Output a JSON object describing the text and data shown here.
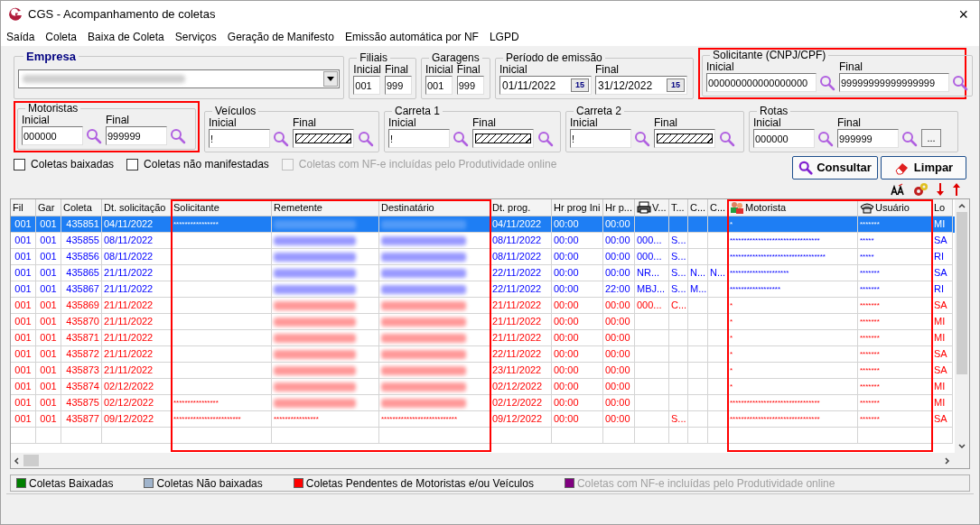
{
  "window": {
    "title": "CGS - Acompanhamento de coletas",
    "close": "×"
  },
  "menu": [
    "Saída",
    "Coleta",
    "Baixa de Coleta",
    "Serviços",
    "Geração de Manifesto",
    "Emissão automática por NF",
    "LGPD"
  ],
  "empresa": {
    "label": "Empresa"
  },
  "filters_row_1": [
    {
      "label": "Filiais",
      "highlighted": false,
      "fields": [
        {
          "label": "Inicial",
          "value": "001",
          "kind": "short"
        },
        {
          "label": "Final",
          "value": "999",
          "kind": "short"
        }
      ]
    },
    {
      "label": "Garagens",
      "highlighted": false,
      "fields": [
        {
          "label": "Inicial",
          "value": "001",
          "kind": "short"
        },
        {
          "label": "Final",
          "value": "999",
          "kind": "short"
        }
      ]
    },
    {
      "label": "Período de emissão",
      "highlighted": false,
      "fields": [
        {
          "label": "Inicial",
          "value": "01/11/2022",
          "kind": "date",
          "button": "15"
        },
        {
          "label": "Final",
          "value": "31/12/2022",
          "kind": "date",
          "button": "15"
        }
      ]
    },
    {
      "label": "Solicitante (CNPJ/CPF)",
      "highlighted": true,
      "fields": [
        {
          "label": "Inicial",
          "value": "000000000000000000",
          "kind": "lookup"
        },
        {
          "label": "Final",
          "value": "99999999999999999",
          "kind": "lookup"
        }
      ]
    }
  ],
  "filters_row_2": [
    {
      "label": "Motoristas",
      "highlighted": true,
      "fields": [
        {
          "label": "Inicial",
          "value": "000000",
          "kind": "lookup"
        },
        {
          "label": "Final",
          "value": "999999",
          "kind": "lookup"
        }
      ]
    },
    {
      "label": "Veículos",
      "highlighted": false,
      "fields": [
        {
          "label": "Inicial",
          "value": "!",
          "kind": "lookup"
        },
        {
          "label": "Final",
          "kind": "hatched"
        }
      ]
    },
    {
      "label": "Carreta 1",
      "highlighted": false,
      "fields": [
        {
          "label": "Inicial",
          "value": "!",
          "kind": "lookup"
        },
        {
          "label": "Final",
          "kind": "hatched"
        }
      ]
    },
    {
      "label": "Carreta 2",
      "highlighted": false,
      "fields": [
        {
          "label": "Inicial",
          "value": "!",
          "kind": "lookup"
        },
        {
          "label": "Final",
          "kind": "hatched"
        }
      ]
    },
    {
      "label": "Rotas",
      "highlighted": false,
      "more": "...",
      "fields": [
        {
          "label": "Inicial",
          "value": "000000",
          "kind": "lookup"
        },
        {
          "label": "Final",
          "value": "999999",
          "kind": "lookup"
        }
      ]
    }
  ],
  "checkboxes": [
    {
      "label": "Coletas baixadas",
      "checked": false,
      "disabled": false
    },
    {
      "label": "Coletas não manifestadas",
      "checked": false,
      "disabled": false
    },
    {
      "label": "Coletas com NF-e incluídas pelo Produtividade online",
      "checked": false,
      "disabled": true
    }
  ],
  "buttons": [
    "Consultar",
    "Limpar"
  ],
  "table": {
    "columns": [
      {
        "label": "Fil",
        "highlighted": false
      },
      {
        "label": "Gar",
        "highlighted": false
      },
      {
        "label": "Coleta",
        "highlighted": false
      },
      {
        "label": "Dt. solicitação",
        "highlighted": false
      },
      {
        "label": "Solicitante",
        "highlighted": true
      },
      {
        "label": "Remetente",
        "highlighted": true
      },
      {
        "label": "Destinatário",
        "highlighted": true
      },
      {
        "label": "Dt. prog.",
        "highlighted": false
      },
      {
        "label": "Hr prog Ini",
        "highlighted": false
      },
      {
        "label": "Hr p...",
        "highlighted": false
      },
      {
        "label": "V...",
        "highlighted": false
      },
      {
        "label": "T...",
        "highlighted": false
      },
      {
        "label": "C...",
        "highlighted": false
      },
      {
        "label": "C...",
        "highlighted": false
      },
      {
        "label": "Motorista",
        "highlighted": true
      },
      {
        "label": "Usuário",
        "highlighted": true
      },
      {
        "label": "Lo",
        "highlighted": false
      }
    ],
    "rows": [
      {
        "selected": true,
        "fil": "001",
        "gar": "001",
        "coleta": "435851",
        "dt_solicitacao": "04/11/2022",
        "solicitante": "****************",
        "remetente_blurred": true,
        "destinatario_blurred": true,
        "dt_prog": "04/11/2022",
        "hr_prog_ini": "00:00",
        "hr_p": "00:00",
        "motorista": "*",
        "usuario": "*******",
        "lo": "MI"
      },
      {
        "selected": false,
        "color": "#0000ff",
        "fil": "001",
        "gar": "001",
        "coleta": "435855",
        "dt_solicitacao": "08/11/2022",
        "remetente_blurred": true,
        "destinatario_blurred": true,
        "dt_prog": "08/11/2022",
        "hr_prog_ini": "00:00",
        "hr_p": "00:00",
        "v": "000...",
        "t": "S...",
        "motorista": "********************************",
        "usuario": "*****",
        "lo": "SA"
      },
      {
        "selected": false,
        "color": "#0000ff",
        "fil": "001",
        "gar": "001",
        "coleta": "435856",
        "dt_solicitacao": "08/11/2022",
        "remetente_blurred": true,
        "destinatario_blurred": true,
        "dt_prog": "08/11/2022",
        "hr_prog_ini": "00:00",
        "hr_p": "00:00",
        "v": "000...",
        "t": "S...",
        "motorista": "**********************************",
        "usuario": "*****",
        "lo": "RI"
      },
      {
        "selected": false,
        "color": "#0000ff",
        "fil": "001",
        "gar": "001",
        "coleta": "435865",
        "dt_solicitacao": "21/11/2022",
        "remetente_blurred": true,
        "destinatario_blurred": true,
        "dt_prog": "22/11/2022",
        "hr_prog_ini": "00:00",
        "hr_p": "00:00",
        "v": "NR...",
        "t": "S...",
        "c_1": "N...",
        "c_2": "N...",
        "motorista": "*********************",
        "usuario": "*******",
        "lo": "SA"
      },
      {
        "selected": false,
        "color": "#0000ff",
        "fil": "001",
        "gar": "001",
        "coleta": "435867",
        "dt_solicitacao": "21/11/2022",
        "remetente_blurred": true,
        "destinatario_blurred": true,
        "dt_prog": "22/11/2022",
        "hr_prog_ini": "00:00",
        "hr_p": "22:00",
        "v": "MBJ...",
        "t": "S...",
        "c_1": "M...",
        "motorista": "******************",
        "usuario": "*******",
        "lo": "RI"
      },
      {
        "selected": false,
        "color": "#ff0000",
        "fil": "001",
        "gar": "001",
        "coleta": "435869",
        "dt_solicitacao": "21/11/2022",
        "remetente_blurred": true,
        "destinatario_blurred": true,
        "dt_prog": "21/11/2022",
        "hr_prog_ini": "00:00",
        "hr_p": "00:00",
        "v": "000...",
        "t": "C...",
        "motorista": "*",
        "usuario": "*******",
        "lo": "SA"
      },
      {
        "selected": false,
        "color": "#ff0000",
        "fil": "001",
        "gar": "001",
        "coleta": "435870",
        "dt_solicitacao": "21/11/2022",
        "remetente_blurred": true,
        "destinatario_blurred": true,
        "dt_prog": "21/11/2022",
        "hr_prog_ini": "00:00",
        "hr_p": "00:00",
        "motorista": "*",
        "usuario": "*******",
        "lo": "MI"
      },
      {
        "selected": false,
        "color": "#ff0000",
        "fil": "001",
        "gar": "001",
        "coleta": "435871",
        "dt_solicitacao": "21/11/2022",
        "remetente_blurred": true,
        "destinatario_blurred": true,
        "dt_prog": "21/11/2022",
        "hr_prog_ini": "00:00",
        "hr_p": "00:00",
        "motorista": "*",
        "usuario": "*******",
        "lo": "MI"
      },
      {
        "selected": false,
        "color": "#ff0000",
        "fil": "001",
        "gar": "001",
        "coleta": "435872",
        "dt_solicitacao": "21/11/2022",
        "remetente_blurred": true,
        "destinatario_blurred": true,
        "dt_prog": "22/11/2022",
        "hr_prog_ini": "00:00",
        "hr_p": "00:00",
        "motorista": "*",
        "usuario": "*******",
        "lo": "SA"
      },
      {
        "selected": false,
        "color": "#ff0000",
        "fil": "001",
        "gar": "001",
        "coleta": "435873",
        "dt_solicitacao": "21/11/2022",
        "remetente_blurred": true,
        "destinatario_blurred": true,
        "dt_prog": "23/11/2022",
        "hr_prog_ini": "00:00",
        "hr_p": "00:00",
        "motorista": "*",
        "usuario": "*******",
        "lo": "SA"
      },
      {
        "selected": false,
        "color": "#ff0000",
        "fil": "001",
        "gar": "001",
        "coleta": "435874",
        "dt_solicitacao": "02/12/2022",
        "remetente_blurred": true,
        "destinatario_blurred": true,
        "dt_prog": "02/12/2022",
        "hr_prog_ini": "00:00",
        "hr_p": "00:00",
        "motorista": "*",
        "usuario": "*******",
        "lo": "MI"
      },
      {
        "selected": false,
        "color": "#ff0000",
        "fil": "001",
        "gar": "001",
        "coleta": "435875",
        "dt_solicitacao": "02/12/2022",
        "solicitante": "****************",
        "remetente_blurred": true,
        "destinatario_blurred": true,
        "dt_prog": "02/12/2022",
        "hr_prog_ini": "00:00",
        "hr_p": "00:00",
        "motorista": "********************************",
        "usuario": "*******",
        "lo": "MI"
      },
      {
        "selected": false,
        "color": "#ff0000",
        "fil": "001",
        "gar": "001",
        "coleta": "435877",
        "dt_solicitacao": "09/12/2022",
        "solicitante": "************************",
        "remetente": "****************",
        "destinatario": "***************************",
        "dt_prog": "09/12/2022",
        "hr_prog_ini": "00:00",
        "hr_p": "00:00",
        "t": "S...",
        "motorista": "********************************",
        "usuario": "*******",
        "lo": "SA"
      }
    ]
  },
  "legend": [
    {
      "label": "Coletas Baixadas",
      "color": "#008000",
      "disabled": false
    },
    {
      "label": "Coletas Não baixadas",
      "color": "#a0b4cc",
      "disabled": false
    },
    {
      "label": "Coletas Pendentes de Motoristas e/ou Veículos",
      "color": "#ff0000",
      "disabled": false
    },
    {
      "label": "Coletas com NF-e incluídas pelo Produtividade online",
      "color": "#800080",
      "disabled": true
    }
  ]
}
